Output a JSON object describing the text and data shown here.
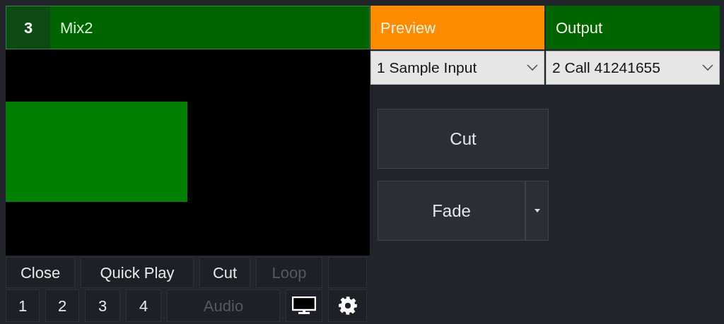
{
  "mix": {
    "number": "3",
    "name": "Mix2"
  },
  "control_rows": [
    [
      {
        "kind": "text",
        "label": "Close",
        "disabled": false
      },
      {
        "kind": "text",
        "label": "Quick Play",
        "disabled": false
      },
      {
        "kind": "text",
        "label": "Cut",
        "disabled": false
      },
      {
        "kind": "text",
        "label": "Loop",
        "disabled": true
      },
      {
        "kind": "blank"
      }
    ],
    [
      {
        "kind": "text",
        "label": "1",
        "disabled": false
      },
      {
        "kind": "text",
        "label": "2",
        "disabled": false
      },
      {
        "kind": "text",
        "label": "3",
        "disabled": false
      },
      {
        "kind": "text",
        "label": "4",
        "disabled": false
      },
      {
        "kind": "text",
        "label": "Audio",
        "disabled": true
      },
      {
        "kind": "monitor"
      },
      {
        "kind": "gear"
      }
    ]
  ],
  "buses": [
    {
      "label": "Preview",
      "color": "#ff8c00",
      "value": "1 Sample Input"
    },
    {
      "label": "Output",
      "color": "#006400",
      "value": "2 Call 41241655"
    }
  ],
  "transitions": [
    {
      "label": "Cut",
      "has_menu": false
    },
    {
      "label": "Fade",
      "has_menu": true
    }
  ]
}
